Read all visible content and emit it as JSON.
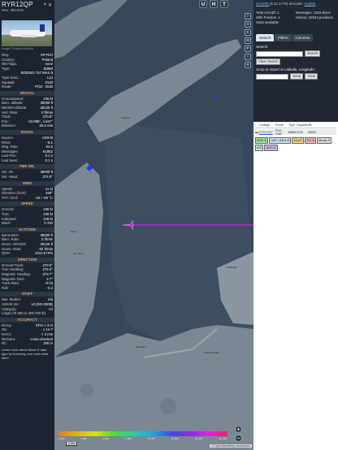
{
  "aircraft": {
    "callsign": "RYR12QP",
    "hex_line": "Hex: 48C2A8",
    "photo_credit": "Image © Radim Koblížka"
  },
  "details": [
    {
      "k": "Reg.:",
      "v": "SP-RZJ"
    },
    {
      "k": "Country:",
      "v": "Poland"
    },
    {
      "k": "DB Flags:",
      "v": "none"
    },
    {
      "k": "Type:",
      "v": "B38M"
    },
    {
      "k": "",
      "v": "BOEING 737 MAX 8"
    },
    {
      "k": "Type Desc.:",
      "v": "L2J"
    },
    {
      "k": "Squawk:",
      "v": "3120"
    },
    {
      "k": "Route:",
      "v": "POZ - DUB"
    }
  ],
  "sections": [
    {
      "title": "SPATIAL",
      "rows": [
        {
          "k": "Groundspeed:",
          "v": "436 kt"
        },
        {
          "k": "Baro. altitude:",
          "v": "38000 ft"
        },
        {
          "k": "WGS84 altitude:",
          "v": "39125 ft"
        },
        {
          "k": "Vert. Rate:",
          "v": "0 ft/min"
        },
        {
          "k": "Track:",
          "v": "270.8°"
        },
        {
          "k": "Pos.:",
          "v": "53.098°, 4.947°"
        },
        {
          "k": "Distance:",
          "v": "35.6 nmi"
        }
      ]
    },
    {
      "title": "SIGNAL",
      "rows": [
        {
          "k": "Source:",
          "v": "ADS-B"
        },
        {
          "k": "RSSI:",
          "v": "-5.1"
        },
        {
          "k": "Msg. Rate:",
          "v": "54.5"
        },
        {
          "k": "Messages:",
          "v": "61852"
        },
        {
          "k": "Last Pos.:",
          "v": "0.1 s"
        },
        {
          "k": "Last Seen:",
          "v": "0.1 s"
        }
      ]
    },
    {
      "title": "FMS SEL",
      "rows": [
        {
          "k": "Sel. Alt.:",
          "v": "38000 ft"
        },
        {
          "k": "Sel. Head.:",
          "v": "274.9°"
        }
      ]
    },
    {
      "title": "WIND",
      "rows": [
        {
          "k": "Speed:",
          "v": "41 kt"
        },
        {
          "k": "Direction (from):",
          "v": "349°"
        },
        {
          "k": "TAT / OAT:",
          "v": "-34 / -60 °C"
        }
      ]
    },
    {
      "title": "SPEED",
      "rows": [
        {
          "k": "Ground:",
          "v": "436 kt"
        },
        {
          "k": "True:",
          "v": "446 kt"
        },
        {
          "k": "Indicated:",
          "v": "248 kt"
        },
        {
          "k": "Mach:",
          "v": "0.784"
        }
      ]
    },
    {
      "title": "ALTITUDE",
      "rows": [
        {
          "k": "Barometric:",
          "v": "38000 ft"
        },
        {
          "k": "Baro. Rate:",
          "v": "0 ft/min"
        },
        {
          "k": "Geom. WGS84:",
          "v": "39125 ft"
        },
        {
          "k": "Geom. Rate:",
          "v": "-32 ft/min"
        },
        {
          "k": "QNH:",
          "v": "1013.6 hPa"
        }
      ]
    },
    {
      "title": "DIRECTION",
      "rows": [
        {
          "k": "Ground Track:",
          "v": "270.8°"
        },
        {
          "k": "True Heading:",
          "v": "276.3°"
        },
        {
          "k": "Magnetic Heading:",
          "v": "273.7°"
        },
        {
          "k": "Magnetic Decl.:",
          "v": "2.7°"
        },
        {
          "k": "Track Rate:",
          "v": "-0.03"
        },
        {
          "k": "Roll:",
          "v": "-0.2"
        }
      ]
    },
    {
      "title": "STUFF",
      "rows": [
        {
          "k": "Nav. Modes:",
          "v": "n/a"
        },
        {
          "k": "ADS-B Ver.:",
          "v": "v2 (DO-260B)"
        },
        {
          "k": "Category:",
          "v": "A3"
        },
        {
          "k": "Large (75 000 to 300 000 lb)",
          "v": ""
        }
      ]
    },
    {
      "title": "ACCURACY",
      "rows": [
        {
          "k": "NACp:",
          "v": "EPU < 3 m"
        },
        {
          "k": "SIL:",
          "v": "≤ 1e-7"
        },
        {
          "k": "NACv:",
          "v": "< 3 m/s"
        },
        {
          "k": "NICbaro:",
          "v": "cross-checked"
        },
        {
          "k": "Rc:",
          "v": "186 m"
        }
      ]
    }
  ],
  "footnote": "Learn more about Mode S data type by hovering over each data label.",
  "map": {
    "top_buttons": [
      "U",
      "H",
      "T"
    ],
    "side_buttons": [
      ">",
      "O",
      "K",
      "M",
      "P",
      "I",
      "R"
    ],
    "zoom_in": "+",
    "zoom_out": "−",
    "scale": "5 NM",
    "attribution": "© OpenStreetMap contributors",
    "altitude_legend": [
      "2 000",
      "4 000",
      "6 000",
      "8 000",
      "10 000",
      "20 000",
      "30 000",
      "40 000+"
    ],
    "places": [
      "Den Burg",
      "Texel",
      "Vlieland",
      "Harlingen",
      "Breezanddijk",
      "Wieringen"
    ],
    "colors": {
      "water": "#37485a",
      "land": "#7b8893",
      "track": "#c226e0",
      "marker": "#1e3cf5"
    }
  },
  "right_panel": {
    "version_prefix": "tar1090 ",
    "version": "(3.14.1776) decoder: ",
    "version_link": "readsb",
    "stats": [
      {
        "k": "Total Aircraft: 1",
        "v": "Messages: 1942.8/sec"
      },
      {
        "k": "With Position: 1",
        "v": "History: 22522 positions"
      },
      {
        "k": "Stats available",
        "v": ""
      }
    ],
    "tabs": [
      "Search",
      "Filters",
      "Columns"
    ],
    "search_label": "Search:",
    "search_button": "Search",
    "clear_search": "Clear Search",
    "jump_label": "Jump to Airport or Latitude, Longitude:",
    "jump_button": "Jump",
    "clear_button": "Clear",
    "table_headers": [
      "",
      "Callsign",
      "Route",
      "Type",
      "Squawk",
      "Alt."
    ],
    "table_row": {
      "callsign": "RYR12QP",
      "route": "POZ - DUB",
      "type": "B38M",
      "squawk": "3120",
      "alt": "38000"
    },
    "sources": [
      {
        "label": "ADS-B",
        "color": "#9ee39e"
      },
      {
        "label": "UAT / ADS-R",
        "color": "#c7e1f7"
      },
      {
        "label": "MLAT",
        "color": "#f5d07a"
      },
      {
        "label": "TIS-B",
        "color": "#f2b6b6"
      },
      {
        "label": "Mode-S",
        "color": "#dcdcdc"
      },
      {
        "label": "AIS",
        "color": "#bfe3d4"
      },
      {
        "label": "ADS-C",
        "color": "#c7b9e8"
      }
    ]
  }
}
